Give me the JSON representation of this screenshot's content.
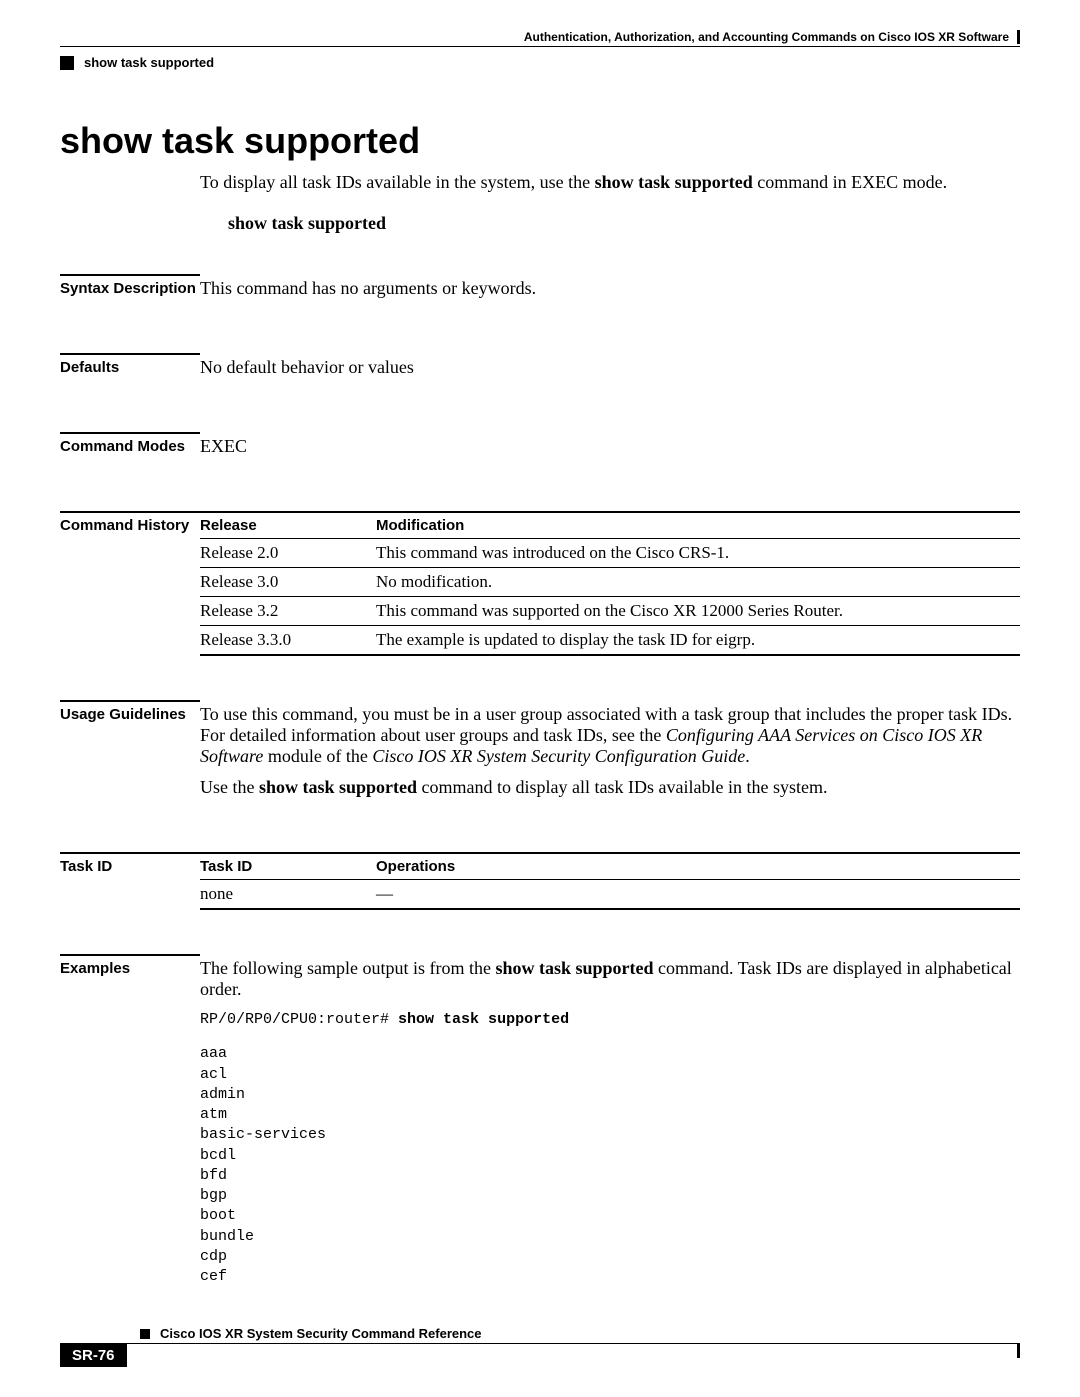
{
  "header": {
    "chapter": "Authentication, Authorization, and Accounting Commands on Cisco IOS XR Software",
    "command_ref": "show task supported"
  },
  "title": "show task supported",
  "intro": {
    "pre": "To display all task IDs available in the system, use the ",
    "bold": "show task supported",
    "post": " command in EXEC mode."
  },
  "syntax_line": "show task supported",
  "sections": {
    "syntax_description": {
      "label": "Syntax Description",
      "text": "This command has no arguments or keywords."
    },
    "defaults": {
      "label": "Defaults",
      "text": "No default behavior or values"
    },
    "command_modes": {
      "label": "Command Modes",
      "text": "EXEC"
    },
    "command_history": {
      "label": "Command History",
      "col1": "Release",
      "col2": "Modification",
      "rows": [
        {
          "release": "Release 2.0",
          "mod": "This command was introduced on the Cisco CRS-1."
        },
        {
          "release": "Release 3.0",
          "mod": "No modification."
        },
        {
          "release": "Release 3.2",
          "mod": "This command was supported on the Cisco XR 12000 Series Router."
        },
        {
          "release": "Release 3.3.0",
          "mod": "The example is updated to display the task ID for eigrp."
        }
      ]
    },
    "usage_guidelines": {
      "label": "Usage Guidelines",
      "p1_pre": "To use this command, you must be in a user group associated with a task group that includes the proper task IDs. For detailed information about user groups and task IDs, see the ",
      "p1_i1": "Configuring AAA Services on Cisco IOS XR Software",
      "p1_mid": " module of the ",
      "p1_i2": "Cisco IOS XR System Security Configuration Guide",
      "p1_post": ".",
      "p2_pre": "Use the ",
      "p2_bold": "show task supported",
      "p2_post": " command to display all task IDs available in the system."
    },
    "task_id": {
      "label": "Task ID",
      "col1": "Task ID",
      "col2": "Operations",
      "rows": [
        {
          "tid": "none",
          "ops": "—"
        }
      ]
    },
    "examples": {
      "label": "Examples",
      "p1_pre": "The following sample output is from the ",
      "p1_bold": "show task supported",
      "p1_post": " command. Task IDs are displayed in alphabetical order.",
      "prompt": "RP/0/RP0/CPU0:router# ",
      "prompt_cmd": "show task supported",
      "output": "aaa\nacl\nadmin\natm\nbasic-services\nbcdl\nbfd\nbgp\nboot\nbundle\ncdp\ncef"
    }
  },
  "footer": {
    "book": "Cisco IOS XR System Security Command Reference",
    "page": "SR-76"
  }
}
